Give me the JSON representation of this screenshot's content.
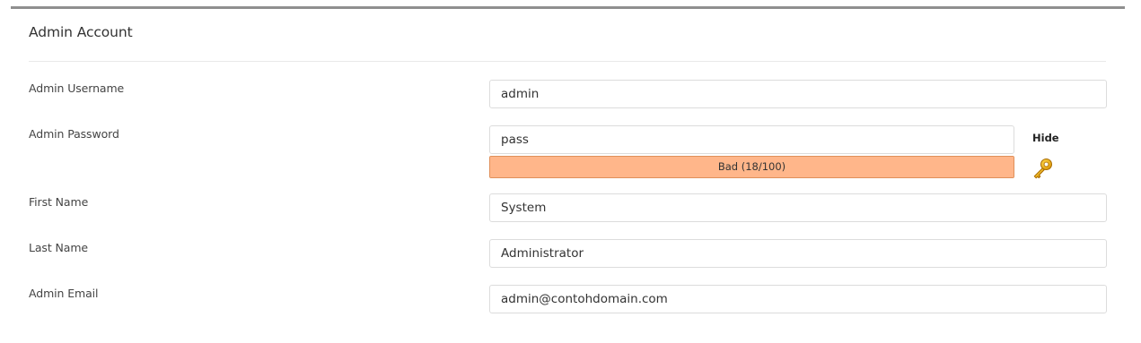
{
  "panel": {
    "title": "Admin Account"
  },
  "fields": {
    "username": {
      "label": "Admin Username",
      "value": "admin"
    },
    "password": {
      "label": "Admin Password",
      "value": "pass",
      "toggle_label": "Hide",
      "strength_text": "Bad (18/100)",
      "strength_score": 18,
      "strength_color": "#ffb68a"
    },
    "first_name": {
      "label": "First Name",
      "value": "System"
    },
    "last_name": {
      "label": "Last Name",
      "value": "Administrator"
    },
    "email": {
      "label": "Admin Email",
      "value": "admin@contohdomain.com"
    }
  },
  "icons": {
    "generate_password": "key-icon"
  }
}
